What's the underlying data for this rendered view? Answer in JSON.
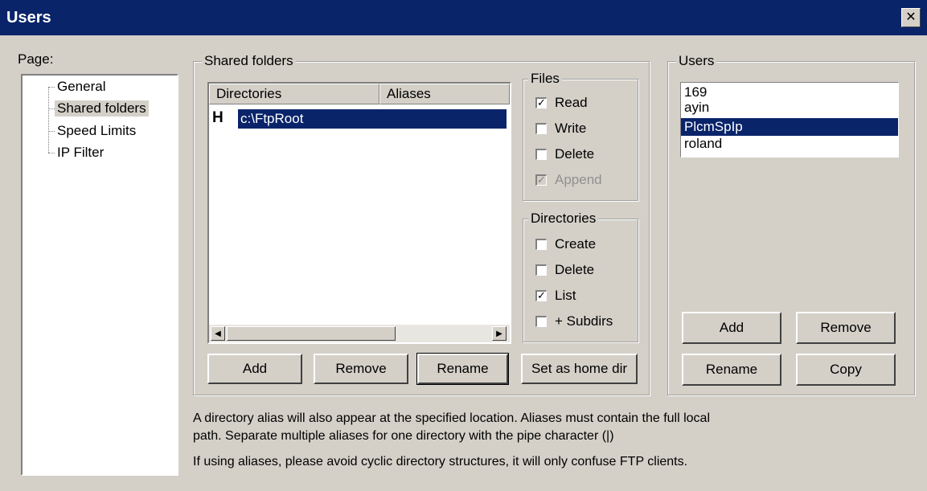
{
  "window": {
    "title": "Users",
    "close_glyph": "✕"
  },
  "page_nav": {
    "label": "Page:",
    "items": [
      "General",
      "Shared folders",
      "Speed Limits",
      "IP Filter"
    ],
    "selected": "Shared folders"
  },
  "shared_folders": {
    "caption": "Shared folders",
    "columns": [
      "Directories",
      "Aliases"
    ],
    "rows": [
      {
        "marker": "H",
        "directory": "c:\\FtpRoot",
        "alias": "",
        "selected": true
      }
    ],
    "buttons": {
      "add": "Add",
      "remove": "Remove",
      "rename": "Rename",
      "set_home": "Set as home dir"
    }
  },
  "files_group": {
    "caption": "Files",
    "options": [
      {
        "label": "Read",
        "checked": true,
        "enabled": true
      },
      {
        "label": "Write",
        "checked": false,
        "enabled": true
      },
      {
        "label": "Delete",
        "checked": false,
        "enabled": true
      },
      {
        "label": "Append",
        "checked": true,
        "enabled": false
      }
    ]
  },
  "directories_group": {
    "caption": "Directories",
    "options": [
      {
        "label": "Create",
        "checked": false
      },
      {
        "label": "Delete",
        "checked": false
      },
      {
        "label": "List",
        "checked": true
      },
      {
        "label": "+ Subdirs",
        "checked": false
      }
    ]
  },
  "users": {
    "caption": "Users",
    "list": [
      "169",
      "ayin",
      "PlcmSpIp",
      "roland"
    ],
    "selected": "PlcmSpIp",
    "buttons": {
      "add": "Add",
      "remove": "Remove",
      "rename": "Rename",
      "copy": "Copy"
    }
  },
  "info": {
    "line1": "A directory alias will also appear at the specified location. Aliases must contain the full local",
    "line2": "path. Separate multiple aliases for one directory with the pipe character (|)",
    "line3": "If using aliases, please avoid cyclic directory structures, it will only confuse FTP clients."
  },
  "icons": {
    "check": "✓",
    "scroll_left": "◀",
    "scroll_right": "▶"
  },
  "colors": {
    "title_bar": "#0a246a",
    "dialog_bg": "#d4d0c8",
    "selection": "#0a246a"
  }
}
